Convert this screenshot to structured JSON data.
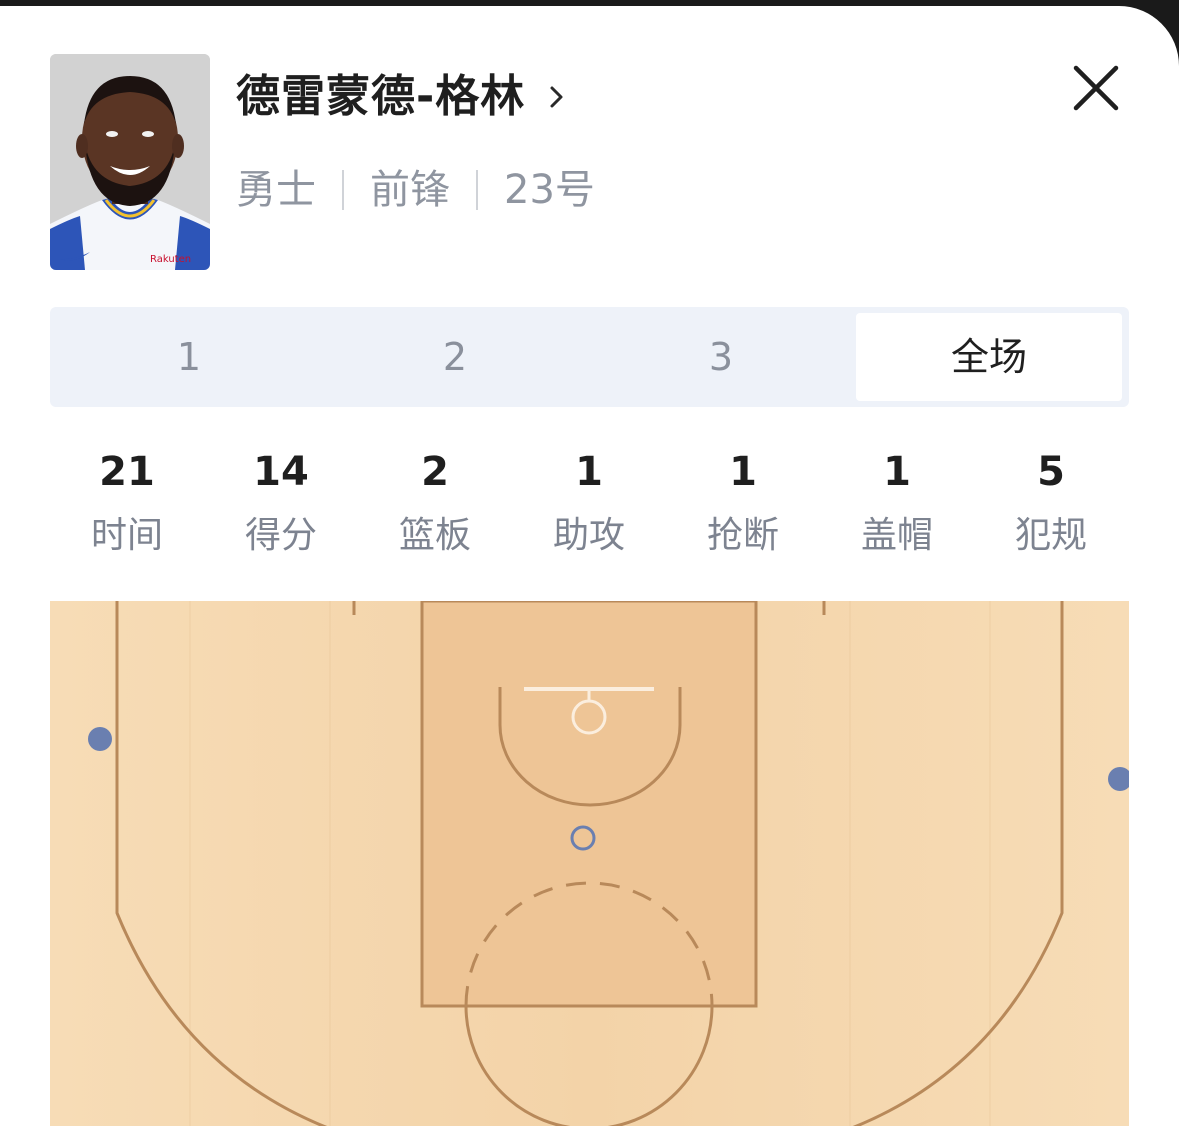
{
  "player": {
    "name": "德雷蒙德-格林",
    "team": "勇士",
    "position": "前锋",
    "number": "23号",
    "jersey_sponsor": "Rakuten"
  },
  "icons": {
    "chevron": "chevron-right-icon",
    "close": "close-icon"
  },
  "tabs": [
    {
      "label": "1",
      "active": false
    },
    {
      "label": "2",
      "active": false
    },
    {
      "label": "3",
      "active": false
    },
    {
      "label": "全场",
      "active": true
    }
  ],
  "stats": [
    {
      "value": "21",
      "label": "时间"
    },
    {
      "value": "14",
      "label": "得分"
    },
    {
      "value": "2",
      "label": "篮板"
    },
    {
      "value": "1",
      "label": "助攻"
    },
    {
      "value": "1",
      "label": "抢断"
    },
    {
      "value": "1",
      "label": "盖帽"
    },
    {
      "value": "5",
      "label": "犯规"
    }
  ],
  "shot_chart": {
    "made_color": "#6a7fb0",
    "court_color": "#f6d9b2",
    "line_color": "#b8895a"
  }
}
